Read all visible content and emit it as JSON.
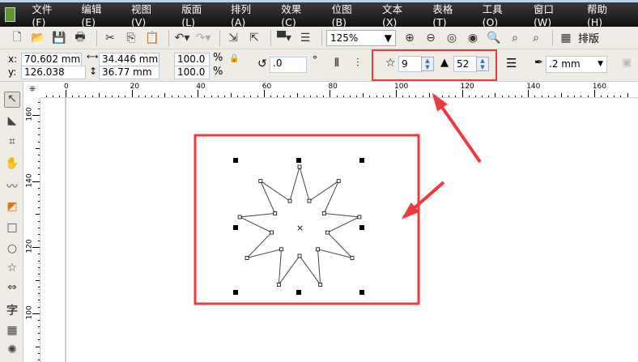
{
  "menu": [
    "文件(F)",
    "编辑(E)",
    "视图(V)",
    "版面(L)",
    "排列(A)",
    "效果(C)",
    "位图(B)",
    "文本(X)",
    "表格(T)",
    "工具(O)",
    "窗口(W)",
    "帮助(H)"
  ],
  "toolbar": {
    "zoom": "125%",
    "layout_label": "排版"
  },
  "props": {
    "x_label": "x:",
    "x": "70.602 mm",
    "y_label": "y:",
    "y": "126.038 mm",
    "width": "34.446 mm",
    "height": "36.77 mm",
    "scale_x": "100.0",
    "scale_y": "100.0",
    "pct": "%",
    "rotation": ".0",
    "degree": "°",
    "star_points": "9",
    "star_sharpness": "52",
    "outline_width": ".2 mm"
  },
  "ruler": {
    "h": [
      "0",
      "20",
      "40",
      "60",
      "80",
      "100",
      "120",
      "140",
      "160"
    ],
    "v": [
      "160",
      "140",
      "120",
      "100"
    ]
  },
  "tools": [
    "pick",
    "shape",
    "crop",
    "pan",
    "freehand",
    "smart-fill",
    "rectangle",
    "ellipse",
    "star",
    "arrow-shapes",
    "text",
    "table",
    "interactive"
  ],
  "tool_text_glyph": "字",
  "star": {
    "points": 9,
    "sharpness": 52
  },
  "colors": {
    "highlight": "#f0393c"
  }
}
